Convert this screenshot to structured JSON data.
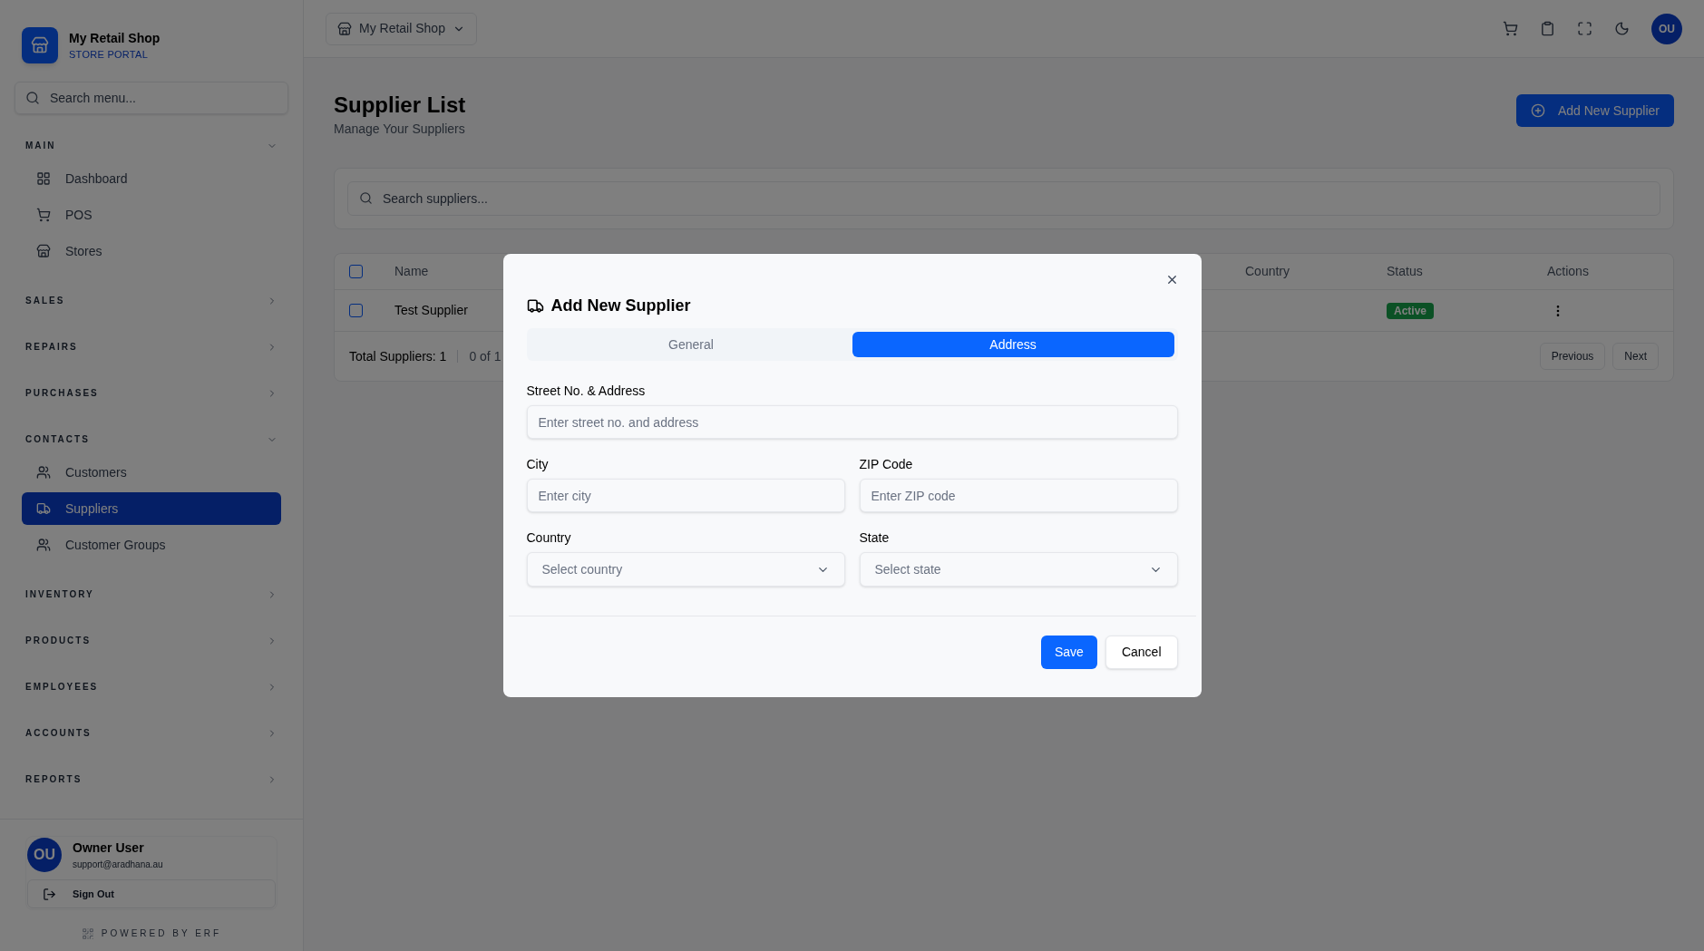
{
  "brand": {
    "name": "My Retail Shop",
    "subtitle": "STORE PORTAL"
  },
  "sidebar": {
    "search_placeholder": "Search menu...",
    "sections": [
      {
        "title": "MAIN",
        "expanded": true,
        "items": [
          {
            "label": "Dashboard",
            "kind": "dashboard",
            "selected": false
          },
          {
            "label": "POS",
            "kind": "cart",
            "selected": false
          },
          {
            "label": "Stores",
            "kind": "store",
            "selected": false
          }
        ]
      },
      {
        "title": "SALES",
        "expanded": false
      },
      {
        "title": "REPAIRS",
        "expanded": false
      },
      {
        "title": "PURCHASES",
        "expanded": false
      },
      {
        "title": "CONTACTS",
        "expanded": true,
        "items": [
          {
            "label": "Customers",
            "kind": "users",
            "selected": false
          },
          {
            "label": "Suppliers",
            "kind": "truck",
            "selected": true
          },
          {
            "label": "Customer Groups",
            "kind": "users",
            "selected": false
          }
        ]
      },
      {
        "title": "INVENTORY",
        "expanded": false
      },
      {
        "title": "PRODUCTS",
        "expanded": false
      },
      {
        "title": "EMPLOYEES",
        "expanded": false
      },
      {
        "title": "ACCOUNTS",
        "expanded": false
      },
      {
        "title": "REPORTS",
        "expanded": false
      }
    ],
    "user": {
      "initials": "OU",
      "name": "Owner User",
      "email": "support@aradhana.au"
    },
    "sign_out": "Sign Out",
    "powered_by": "POWERED BY ERF"
  },
  "topbar": {
    "store": "My Retail Shop",
    "avatar": "OU"
  },
  "page": {
    "title": "Supplier List",
    "subtitle": "Manage Your Suppliers",
    "add_button": "Add New Supplier",
    "search_placeholder": "Search suppliers..."
  },
  "table": {
    "columns": [
      "Name",
      "Country",
      "Status",
      "Actions"
    ],
    "rows": [
      {
        "checked": false,
        "name": "Test Supplier",
        "status": "Active"
      }
    ],
    "all_checked": false,
    "total": "Total Suppliers: 1",
    "range": "0 of 1",
    "previous": "Previous",
    "next": "Next"
  },
  "modal": {
    "title": "Add New Supplier",
    "tabs": [
      {
        "label": "General",
        "selected": false
      },
      {
        "label": "Address",
        "selected": true
      }
    ],
    "fields": [
      {
        "kind": "input",
        "label": "Street No. & Address",
        "placeholder": "Enter street no. and address"
      },
      {
        "kind": "input",
        "label": "City",
        "placeholder": "Enter city"
      },
      {
        "kind": "input",
        "label": "ZIP Code",
        "placeholder": "Enter ZIP code"
      },
      {
        "kind": "select",
        "label": "Country",
        "placeholder": "Select country"
      },
      {
        "kind": "select",
        "label": "State",
        "placeholder": "Select state"
      }
    ],
    "save": "Save",
    "cancel": "Cancel"
  }
}
